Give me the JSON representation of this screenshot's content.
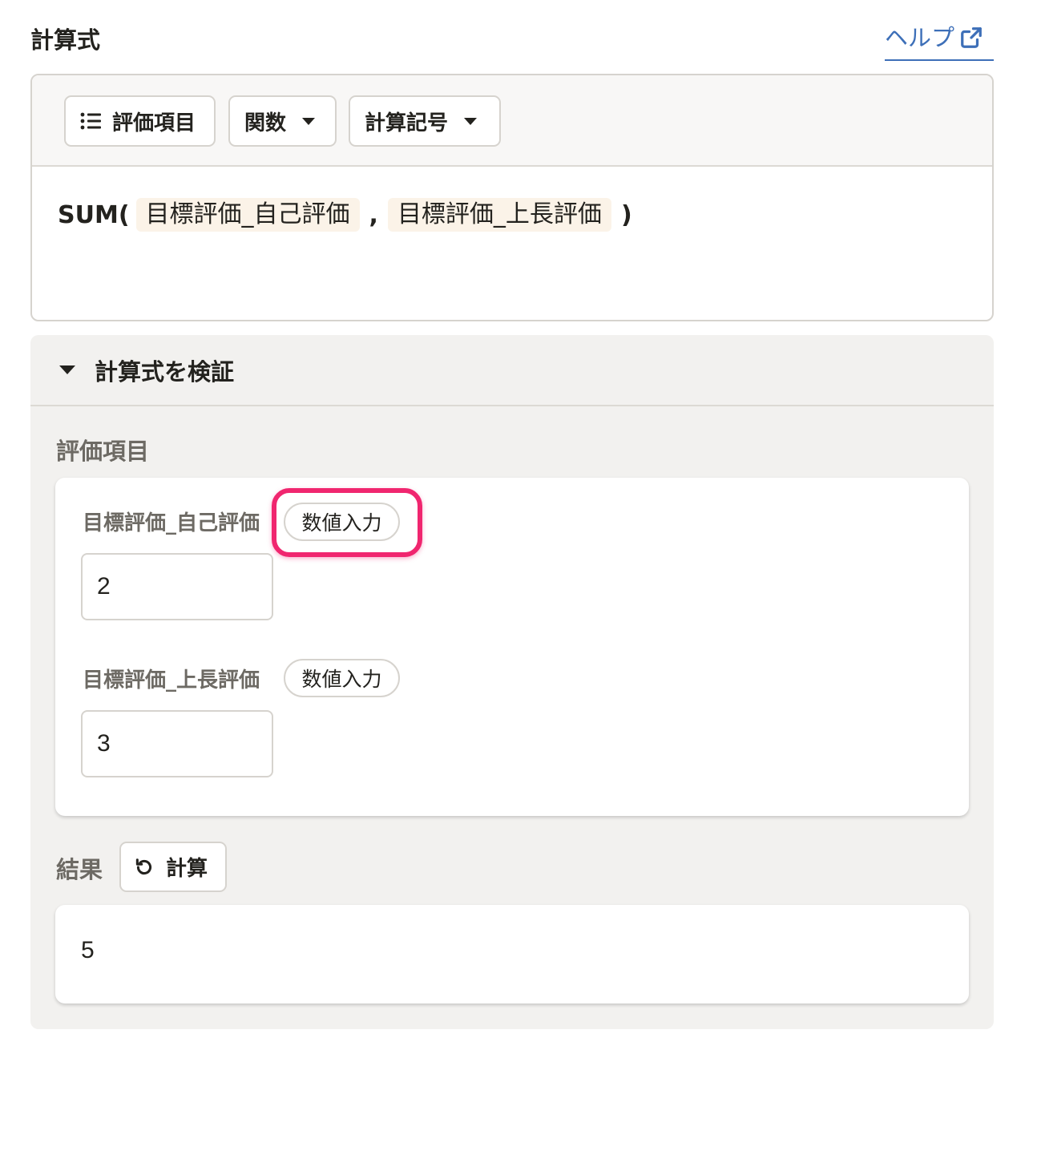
{
  "header": {
    "title": "計算式",
    "help_label": "ヘルプ"
  },
  "toolbar": {
    "items_button": "評価項目",
    "functions_button": "関数",
    "operators_button": "計算記号"
  },
  "formula": {
    "function": "SUM(",
    "tokens": [
      "目標評価_自己評価",
      "目標評価_上長評価"
    ],
    "separator": ",",
    "close": ")"
  },
  "verify": {
    "title": "計算式を検証",
    "items_label": "評価項目",
    "fields": [
      {
        "label": "目標評価_自己評価",
        "badge": "数値入力",
        "value": "2"
      },
      {
        "label": "目標評価_上長評価",
        "badge": "数値入力",
        "value": "3"
      }
    ],
    "result_label": "結果",
    "calc_button": "計算",
    "result_value": "5"
  },
  "colors": {
    "link": "#3d6fb8",
    "highlight": "#f0266f",
    "token_bg": "#fbf3e8",
    "panel_bg": "#f2f1ef"
  }
}
